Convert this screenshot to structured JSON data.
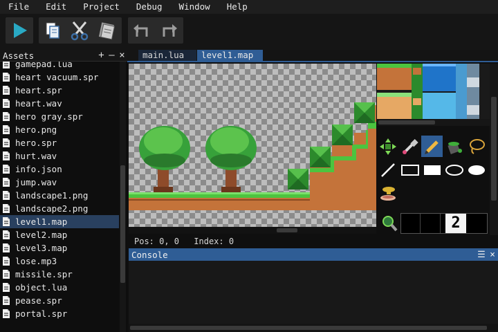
{
  "menu": {
    "items": [
      "File",
      "Edit",
      "Project",
      "Debug",
      "Window",
      "Help"
    ]
  },
  "toolbar": {
    "buttons": [
      "play-icon",
      "copy-icon",
      "cut-icon",
      "paste-icon",
      "undo-icon",
      "redo-icon"
    ]
  },
  "assets": {
    "title": "Assets",
    "add": "+",
    "collapse": "—",
    "close": "×",
    "files": [
      "gamepad.lua",
      "heart vacuum.spr",
      "heart.spr",
      "heart.wav",
      "hero gray.spr",
      "hero.png",
      "hero.spr",
      "hurt.wav",
      "info.json",
      "jump.wav",
      "landscape1.png",
      "landscape2.png",
      "level1.map",
      "level2.map",
      "level3.map",
      "lose.mp3",
      "missile.spr",
      "object.lua",
      "pease.spr",
      "portal.spr"
    ],
    "selected": "level1.map"
  },
  "tabs": [
    {
      "label": "main.lua",
      "active": false
    },
    {
      "label": "level1.map",
      "active": true
    }
  ],
  "map": {
    "pos_label": "Pos: 0, 0",
    "index_label": "Index: 0"
  },
  "tools": {
    "items": [
      "move-icon",
      "eyedropper-icon",
      "pencil-icon",
      "bucket-icon",
      "lasso-icon",
      "line-icon",
      "rect-outline-icon",
      "rect-fill-icon",
      "ellipse-outline-icon",
      "ellipse-fill-icon",
      "stamp-icon"
    ],
    "selected": "pencil-icon"
  },
  "layer": {
    "value": "2"
  },
  "console": {
    "title": "Console",
    "clear": "☰",
    "close": "×"
  },
  "colors": {
    "accent": "#2f5d95",
    "grass": "#3fae3a",
    "dirt": "#c97c3a",
    "tree_leaves": "#37a13a",
    "trunk": "#8e4b2a"
  }
}
